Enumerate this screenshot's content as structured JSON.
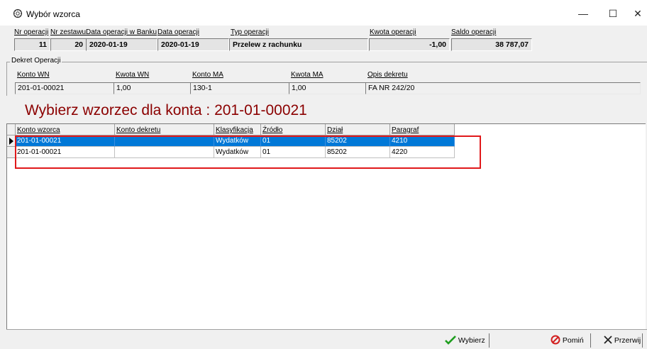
{
  "window": {
    "title": "Wybór wzorca",
    "minimize": "—",
    "maximize": "☐",
    "close": "✕"
  },
  "header": {
    "labels": {
      "nr_operacji": "Nr operacji",
      "nr_zestawu": "Nr zestawu",
      "data_operacji_w_banku": "Data operacji w Banku",
      "data_operacji": "Data operacji",
      "typ_operacji": "Typ operacji",
      "kwota_operacji": "Kwota operacji",
      "saldo_operacji": "Saldo operacji"
    },
    "values": {
      "nr_operacji": "11",
      "nr_zestawu": "20",
      "data_operacji_w_banku": "2020-01-19",
      "data_operacji": "2020-01-19",
      "typ_operacji": "Przelew z rachunku",
      "kwota_operacji": "-1,00",
      "saldo_operacji": "38 787,07"
    }
  },
  "dekret": {
    "group_title": "Dekret Operacji",
    "labels": {
      "konto_wn": "Konto WN",
      "kwota_wn": "Kwota WN",
      "konto_ma": "Konto MA",
      "kwota_ma": "Kwota MA",
      "opis": "Opis dekretu"
    },
    "values": {
      "konto_wn": "201-01-00021",
      "kwota_wn": "1,00",
      "konto_ma": "130-1",
      "kwota_ma": "1,00",
      "opis": "FA NR 242/20"
    }
  },
  "heading": "Wybierz wzorzec dla konta : 201-01-00021",
  "grid": {
    "columns": [
      "Konto wzorca",
      "Konto dekretu",
      "Klasyfikacja",
      "Źródło",
      "Dział",
      "Paragraf"
    ],
    "rows": [
      [
        "201-01-00021",
        "",
        "Wydatków",
        "01",
        "85202",
        "4210"
      ],
      [
        "201-01-00021",
        "",
        "Wydatków",
        "01",
        "85202",
        "4220"
      ]
    ],
    "selected_row": 0
  },
  "footer": {
    "wybierz": "Wybierz",
    "pomin": "Pomiń",
    "przerwij": "Przerwij"
  },
  "colors": {
    "accent_title": "#8b0000",
    "selection": "#0078d7",
    "highlight_box": "#e0191b",
    "check": "#1e9e1e",
    "pomin_icon": "#d21f1f"
  }
}
